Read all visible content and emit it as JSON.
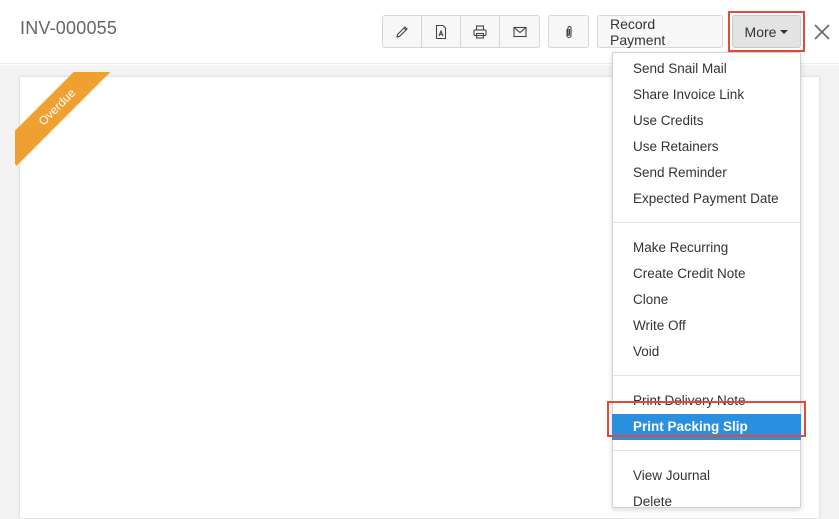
{
  "header": {
    "title": "INV-000055",
    "toolbar": {
      "icon_buttons": [
        {
          "icon": "pencil-icon",
          "label": "Edit"
        },
        {
          "icon": "pdf-icon",
          "label": "PDF"
        },
        {
          "icon": "printer-icon",
          "label": "Print"
        },
        {
          "icon": "envelope-icon",
          "label": "Email"
        }
      ],
      "attach_icon": "paperclip-icon",
      "record_payment_label": "Record Payment",
      "more_label": "More",
      "close_icon": "close-icon"
    }
  },
  "document": {
    "status_ribbon": "Overdue",
    "ribbon_color": "#f0a030"
  },
  "more_menu": {
    "groups": [
      [
        "Send Snail Mail",
        "Share Invoice Link",
        "Use Credits",
        "Use Retainers",
        "Send Reminder",
        "Expected Payment Date"
      ],
      [
        "Make Recurring",
        "Create Credit Note",
        "Clone",
        "Write Off",
        "Void"
      ],
      [
        "Print Delivery Note",
        "Print Packing Slip"
      ],
      [
        "View Journal",
        "Delete"
      ]
    ],
    "highlighted_item": "Print Packing Slip",
    "highlight_color": "#2a8fde",
    "annotation_color": "#e04b3a"
  }
}
